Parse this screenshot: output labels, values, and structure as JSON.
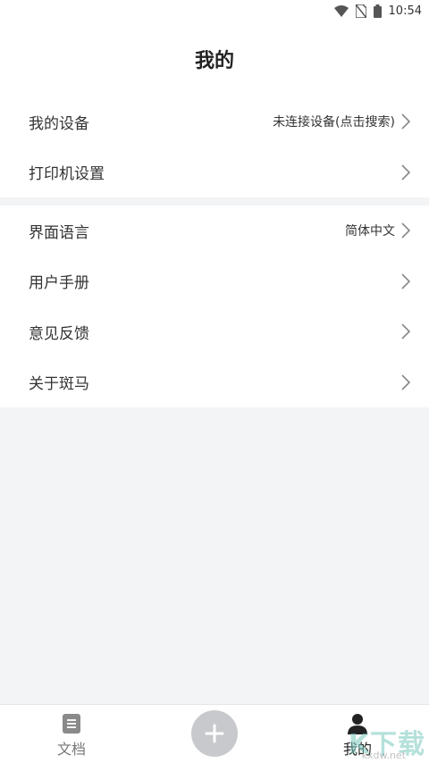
{
  "status_bar": {
    "time": "10:54",
    "icons": [
      "wifi-icon",
      "no-sim-icon",
      "battery-icon"
    ]
  },
  "header": {
    "title": "我的"
  },
  "settings_group_1": [
    {
      "label": "我的设备",
      "value": "未连接设备(点击搜索)"
    },
    {
      "label": "打印机设置",
      "value": ""
    }
  ],
  "settings_group_2": [
    {
      "label": "界面语言",
      "value": "简体中文"
    },
    {
      "label": "用户手册",
      "value": ""
    },
    {
      "label": "意见反馈",
      "value": ""
    },
    {
      "label": "关于斑马",
      "value": ""
    }
  ],
  "bottom_nav": {
    "docs_label": "文档",
    "mine_label": "我的",
    "add_icon": "plus-icon"
  },
  "watermark": {
    "text": "K下载",
    "sub": "kxdw.net"
  },
  "colors": {
    "background": "#f3f4f6",
    "surface": "#ffffff",
    "add_button": "#c7c9cc",
    "text": "#333333"
  }
}
